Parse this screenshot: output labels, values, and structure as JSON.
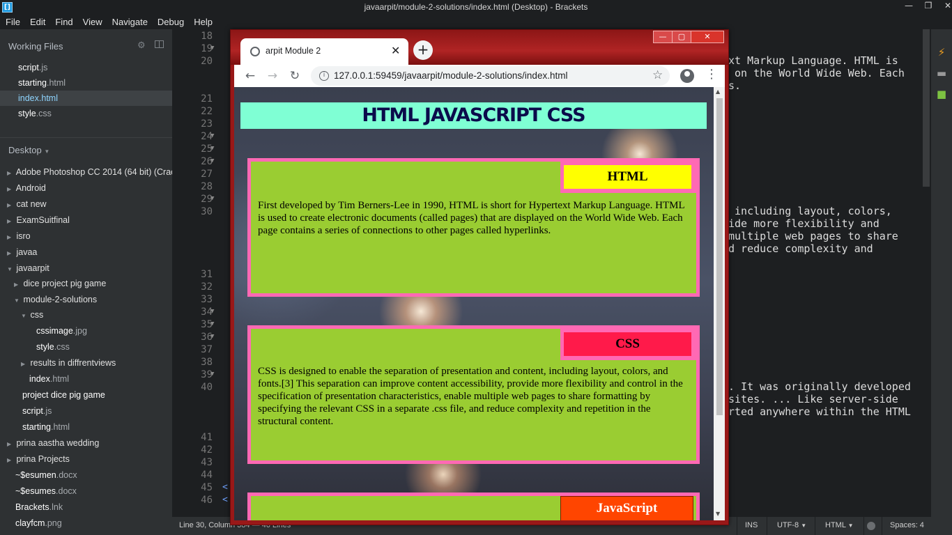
{
  "window": {
    "title": "javaarpit/module-2-solutions/index.html (Desktop) - Brackets",
    "app_icon": "brackets-logo-icon",
    "controls": [
      "minimize-icon",
      "maximize-icon",
      "close-icon"
    ]
  },
  "menu": [
    "File",
    "Edit",
    "Find",
    "View",
    "Navigate",
    "Debug",
    "Help"
  ],
  "sidebar": {
    "working_files_label": "Working Files",
    "working_files": [
      {
        "name": "script",
        "ext": ".js"
      },
      {
        "name": "starting",
        "ext": ".html"
      },
      {
        "name": "index",
        "ext": ".html"
      },
      {
        "name": "style",
        "ext": ".css"
      }
    ],
    "project_title": "Desktop",
    "tree": [
      {
        "label": "Adobe Photoshop CC 2014 (64 bit) (Crac",
        "ext": ""
      },
      {
        "label": "Android",
        "ext": ""
      },
      {
        "label": "cat new",
        "ext": ""
      },
      {
        "label": "ExamSuitfinal",
        "ext": ""
      },
      {
        "label": "isro",
        "ext": ""
      },
      {
        "label": "javaa",
        "ext": ""
      },
      {
        "label": "javaarpit",
        "ext": ""
      },
      {
        "label": "dice project pig game",
        "ext": ""
      },
      {
        "label": "module-2-solutions",
        "ext": ""
      },
      {
        "label": "css",
        "ext": ""
      },
      {
        "label": "cssimage",
        "ext": ".jpg"
      },
      {
        "label": "style",
        "ext": ".css"
      },
      {
        "label": "results in diffrentviews",
        "ext": ""
      },
      {
        "label": "index",
        "ext": ".html"
      },
      {
        "label": "project dice pig game",
        "ext": ""
      },
      {
        "label": "script",
        "ext": ".js"
      },
      {
        "label": "starting",
        "ext": ".html"
      },
      {
        "label": "prina aastha wedding",
        "ext": ""
      },
      {
        "label": "prina Projects",
        "ext": ""
      },
      {
        "label": "~$esumen",
        "ext": ".docx"
      },
      {
        "label": "~$esumes",
        "ext": ".docx"
      },
      {
        "label": "Brackets",
        "ext": ".lnk"
      },
      {
        "label": "clayfcm",
        "ext": ".png"
      }
    ]
  },
  "editor": {
    "line_numbers": [
      "18",
      "19",
      "20",
      "21",
      "22",
      "23",
      "24",
      "25",
      "26",
      "27",
      "28",
      "29",
      "30",
      "31",
      "32",
      "33",
      "34",
      "35",
      "36",
      "37",
      "38",
      "39",
      "40",
      "41",
      "42",
      "43",
      "44",
      "45",
      "46"
    ],
    "code_fragments": [
      "xt Markup Language. HTML is",
      " on the World Wide Web. Each",
      "s.",
      " including layout, colors,",
      "ide more flexibility and",
      "multiple web pages to share",
      "d reduce complexity and",
      ". It was originally developed",
      "sites. ... Like server-side",
      "rted anywhere within the HTML"
    ],
    "tag_marks": [
      "<",
      "<"
    ]
  },
  "statusbar": {
    "cursor": "Line 30, Column 384 — 46 Lines",
    "mode": "INS",
    "encoding": "UTF-8",
    "language": "HTML",
    "spaces": "Spaces: 4"
  },
  "browser": {
    "tab_title": "arpit Module 2",
    "new_tab": "+",
    "url": "127.0.0.1:59459/javaarpit/module-2-solutions/index.html",
    "page": {
      "heading": "HTML JAVASCRIPT CSS",
      "sections": [
        {
          "label": "HTML",
          "label_color": "#ffff00",
          "text": "First developed by Tim Berners-Lee in 1990, HTML is short for Hypertext Markup Language. HTML is used to create electronic documents (called pages) that are displayed on the World Wide Web. Each page contains a series of connections to other pages called hyperlinks."
        },
        {
          "label": "CSS",
          "label_color": "#ff1a4a",
          "text": "CSS is designed to enable the separation of presentation and content, including layout, colors, and fonts.[3] This separation can improve content accessibility, provide more flexibility and control in the specification of presentation characteristics, enable multiple web pages to share formatting by specifying the relevant CSS in a separate .css file, and reduce complexity and repetition in the structural content."
        },
        {
          "label": "JavaScript",
          "label_color": "#ff4500",
          "text": ""
        }
      ]
    }
  },
  "colors": {
    "heading_bg": "#7fffd4",
    "section_bg": "#9acd32",
    "section_border": "#ff69b4",
    "browser_frame": "#991818"
  }
}
